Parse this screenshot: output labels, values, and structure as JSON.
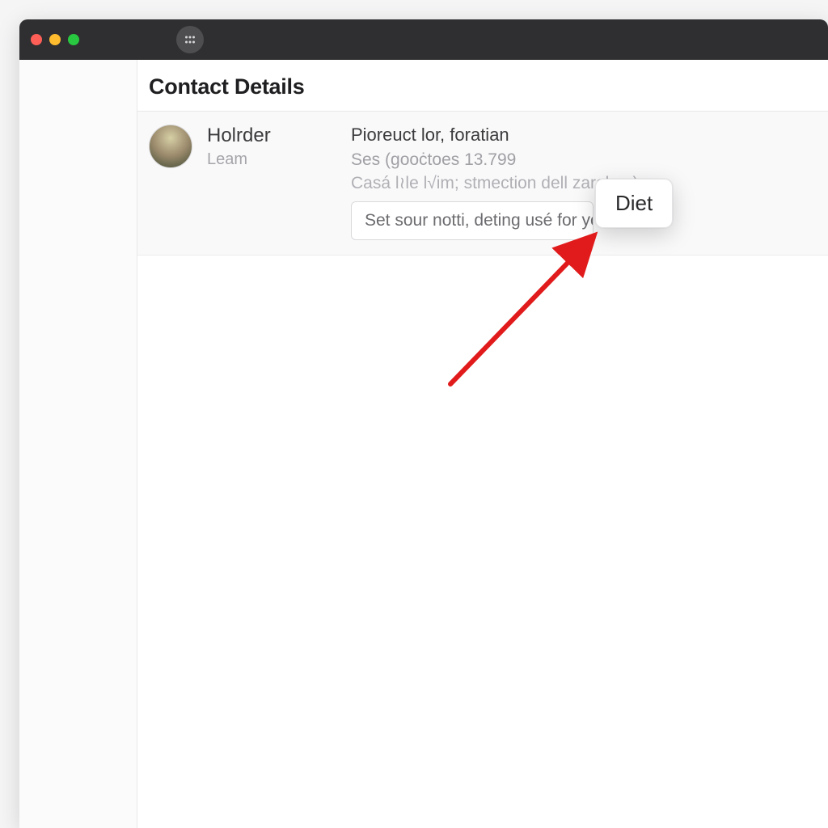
{
  "header": {
    "page_title": "Contact Details"
  },
  "contact": {
    "name": "Holrder",
    "role": "Leam",
    "info_line1": "Pioreuct lor, fоratian",
    "info_line2": "Ses (gooċtoes  13.799",
    "info_line3": "Casá l≀le l√im; stmection dell zarabes)",
    "note_placeholder": "Set sour notti, deting usé for your"
  },
  "popover": {
    "label": "Diet"
  }
}
